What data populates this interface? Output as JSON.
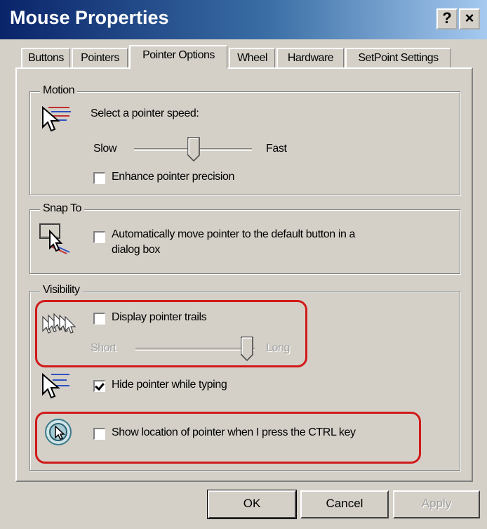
{
  "window": {
    "title": "Mouse Properties",
    "help_button": "?",
    "close_button": "×"
  },
  "tabs": [
    {
      "label": "Buttons"
    },
    {
      "label": "Pointers"
    },
    {
      "label": "Pointer Options"
    },
    {
      "label": "Wheel"
    },
    {
      "label": "Hardware"
    },
    {
      "label": "SetPoint Settings"
    }
  ],
  "active_tab": "Pointer Options",
  "motion": {
    "legend": "Motion",
    "speed_label": "Select a pointer speed:",
    "slow_label": "Slow",
    "fast_label": "Fast",
    "speed_value": 0.5,
    "enhance_label": "Enhance pointer precision",
    "enhance_checked": false
  },
  "snap": {
    "legend": "Snap To",
    "label_line1": "Automatically move pointer to the default button in a",
    "label_line2": "dialog box",
    "checked": false
  },
  "visibility": {
    "legend": "Visibility",
    "trails_label": "Display pointer trails",
    "trails_checked": false,
    "short_label": "Short",
    "long_label": "Long",
    "trail_length_value": 1.0,
    "hide_label": "Hide pointer while typing",
    "hide_checked": true,
    "ctrl_label": "Show location of pointer when I press the CTRL key",
    "ctrl_checked": false
  },
  "buttons": {
    "ok": "OK",
    "cancel": "Cancel",
    "apply": "Apply"
  },
  "colors": {
    "highlight": "#d11a1a",
    "title_start": "#0a246a",
    "title_end": "#a6caf0"
  }
}
